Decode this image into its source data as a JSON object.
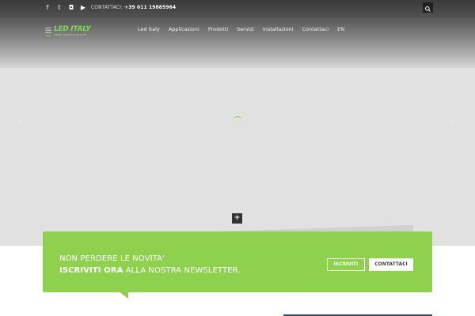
{
  "topbar": {
    "social_icons": [
      "facebook-icon",
      "twitter-icon",
      "instagram-icon",
      "youtube-icon"
    ],
    "social_glyphs": [
      "f",
      "𝕥",
      "◘",
      "▶"
    ],
    "contact_label": "CONTATTACI:",
    "contact_phone": "+39 011 19885964",
    "search_icon": "search-icon"
  },
  "header": {
    "logo_text": "LED ITALY",
    "logo_subtitle": "FROM LIGHT TO QUALITY",
    "nav": [
      "Led Italy",
      "Applicazioni",
      "Prodotti",
      "Servizi",
      "Installazioni",
      "Contattaci",
      "EN"
    ]
  },
  "hero": {
    "prev_glyph": "‹",
    "next_glyph": "›",
    "plus_glyph": "+"
  },
  "newsletter": {
    "line1": "NON PERDERE LE NOVITA'",
    "line2_bold": "ISCRIVITI ORA",
    "line2_rest": " ALLA NOSTRA NEWSLETTER.",
    "subscribe_button": "ISCRIVITI",
    "contact_button": "CONTATTACI"
  },
  "colors": {
    "accent_green": "#8fd14f",
    "logo_green": "#7ed957",
    "topbar_dark": "#3a3a3a",
    "hero_gray": "#e1e1e1"
  }
}
